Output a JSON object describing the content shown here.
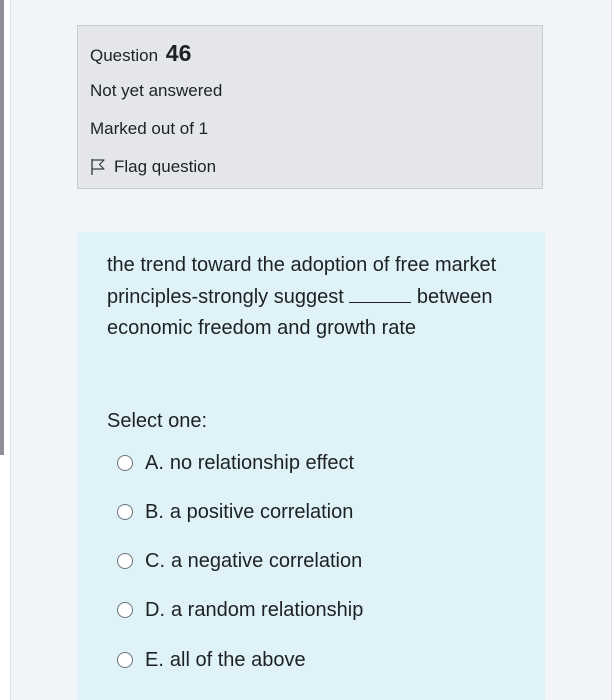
{
  "question": {
    "label": "Question",
    "number": "46",
    "state": "Not yet answered",
    "mark": "Marked out of 1",
    "flag_label": "Flag question"
  },
  "content": {
    "text_before_blank": "the trend toward the adoption of free market principles-strongly suggest",
    "text_after_blank": "between economic freedom and growth rate",
    "prompt": "Select one:",
    "options": [
      {
        "letter": "A.",
        "text": "no relationship effect"
      },
      {
        "letter": "B.",
        "text": "a positive correlation"
      },
      {
        "letter": "C.",
        "text": "a negative correlation"
      },
      {
        "letter": "D.",
        "text": "a random relationship"
      },
      {
        "letter": "E.",
        "text": "all of the above"
      }
    ]
  },
  "colors": {
    "info_background": "#e4e6ea",
    "question_background": "#def2f8",
    "page_background": "#f2f5f8"
  },
  "icons": {
    "flag": "flag-outline-icon",
    "radio": "radio-unchecked-icon"
  }
}
